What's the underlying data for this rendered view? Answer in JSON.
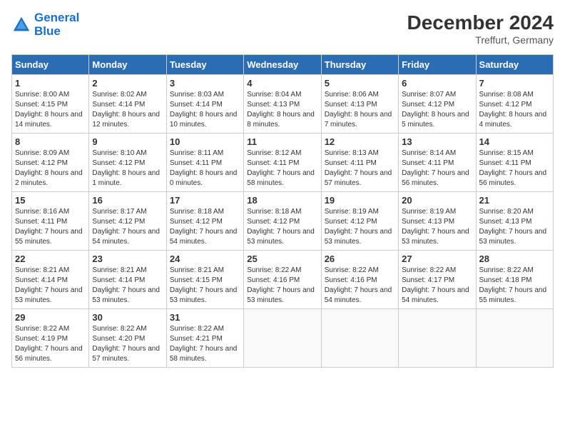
{
  "header": {
    "logo_line1": "General",
    "logo_line2": "Blue",
    "month_year": "December 2024",
    "location": "Treffurt, Germany"
  },
  "days_of_week": [
    "Sunday",
    "Monday",
    "Tuesday",
    "Wednesday",
    "Thursday",
    "Friday",
    "Saturday"
  ],
  "weeks": [
    [
      {
        "day": 1,
        "sunrise": "8:00 AM",
        "sunset": "4:15 PM",
        "daylight": "8 hours and 14 minutes."
      },
      {
        "day": 2,
        "sunrise": "8:02 AM",
        "sunset": "4:14 PM",
        "daylight": "8 hours and 12 minutes."
      },
      {
        "day": 3,
        "sunrise": "8:03 AM",
        "sunset": "4:14 PM",
        "daylight": "8 hours and 10 minutes."
      },
      {
        "day": 4,
        "sunrise": "8:04 AM",
        "sunset": "4:13 PM",
        "daylight": "8 hours and 8 minutes."
      },
      {
        "day": 5,
        "sunrise": "8:06 AM",
        "sunset": "4:13 PM",
        "daylight": "8 hours and 7 minutes."
      },
      {
        "day": 6,
        "sunrise": "8:07 AM",
        "sunset": "4:12 PM",
        "daylight": "8 hours and 5 minutes."
      },
      {
        "day": 7,
        "sunrise": "8:08 AM",
        "sunset": "4:12 PM",
        "daylight": "8 hours and 4 minutes."
      }
    ],
    [
      {
        "day": 8,
        "sunrise": "8:09 AM",
        "sunset": "4:12 PM",
        "daylight": "8 hours and 2 minutes."
      },
      {
        "day": 9,
        "sunrise": "8:10 AM",
        "sunset": "4:12 PM",
        "daylight": "8 hours and 1 minute."
      },
      {
        "day": 10,
        "sunrise": "8:11 AM",
        "sunset": "4:11 PM",
        "daylight": "8 hours and 0 minutes."
      },
      {
        "day": 11,
        "sunrise": "8:12 AM",
        "sunset": "4:11 PM",
        "daylight": "7 hours and 58 minutes."
      },
      {
        "day": 12,
        "sunrise": "8:13 AM",
        "sunset": "4:11 PM",
        "daylight": "7 hours and 57 minutes."
      },
      {
        "day": 13,
        "sunrise": "8:14 AM",
        "sunset": "4:11 PM",
        "daylight": "7 hours and 56 minutes."
      },
      {
        "day": 14,
        "sunrise": "8:15 AM",
        "sunset": "4:11 PM",
        "daylight": "7 hours and 56 minutes."
      }
    ],
    [
      {
        "day": 15,
        "sunrise": "8:16 AM",
        "sunset": "4:11 PM",
        "daylight": "7 hours and 55 minutes."
      },
      {
        "day": 16,
        "sunrise": "8:17 AM",
        "sunset": "4:12 PM",
        "daylight": "7 hours and 54 minutes."
      },
      {
        "day": 17,
        "sunrise": "8:18 AM",
        "sunset": "4:12 PM",
        "daylight": "7 hours and 54 minutes."
      },
      {
        "day": 18,
        "sunrise": "8:18 AM",
        "sunset": "4:12 PM",
        "daylight": "7 hours and 53 minutes."
      },
      {
        "day": 19,
        "sunrise": "8:19 AM",
        "sunset": "4:12 PM",
        "daylight": "7 hours and 53 minutes."
      },
      {
        "day": 20,
        "sunrise": "8:19 AM",
        "sunset": "4:13 PM",
        "daylight": "7 hours and 53 minutes."
      },
      {
        "day": 21,
        "sunrise": "8:20 AM",
        "sunset": "4:13 PM",
        "daylight": "7 hours and 53 minutes."
      }
    ],
    [
      {
        "day": 22,
        "sunrise": "8:21 AM",
        "sunset": "4:14 PM",
        "daylight": "7 hours and 53 minutes."
      },
      {
        "day": 23,
        "sunrise": "8:21 AM",
        "sunset": "4:14 PM",
        "daylight": "7 hours and 53 minutes."
      },
      {
        "day": 24,
        "sunrise": "8:21 AM",
        "sunset": "4:15 PM",
        "daylight": "7 hours and 53 minutes."
      },
      {
        "day": 25,
        "sunrise": "8:22 AM",
        "sunset": "4:16 PM",
        "daylight": "7 hours and 53 minutes."
      },
      {
        "day": 26,
        "sunrise": "8:22 AM",
        "sunset": "4:16 PM",
        "daylight": "7 hours and 54 minutes."
      },
      {
        "day": 27,
        "sunrise": "8:22 AM",
        "sunset": "4:17 PM",
        "daylight": "7 hours and 54 minutes."
      },
      {
        "day": 28,
        "sunrise": "8:22 AM",
        "sunset": "4:18 PM",
        "daylight": "7 hours and 55 minutes."
      }
    ],
    [
      {
        "day": 29,
        "sunrise": "8:22 AM",
        "sunset": "4:19 PM",
        "daylight": "7 hours and 56 minutes."
      },
      {
        "day": 30,
        "sunrise": "8:22 AM",
        "sunset": "4:20 PM",
        "daylight": "7 hours and 57 minutes."
      },
      {
        "day": 31,
        "sunrise": "8:22 AM",
        "sunset": "4:21 PM",
        "daylight": "7 hours and 58 minutes."
      },
      null,
      null,
      null,
      null
    ]
  ]
}
